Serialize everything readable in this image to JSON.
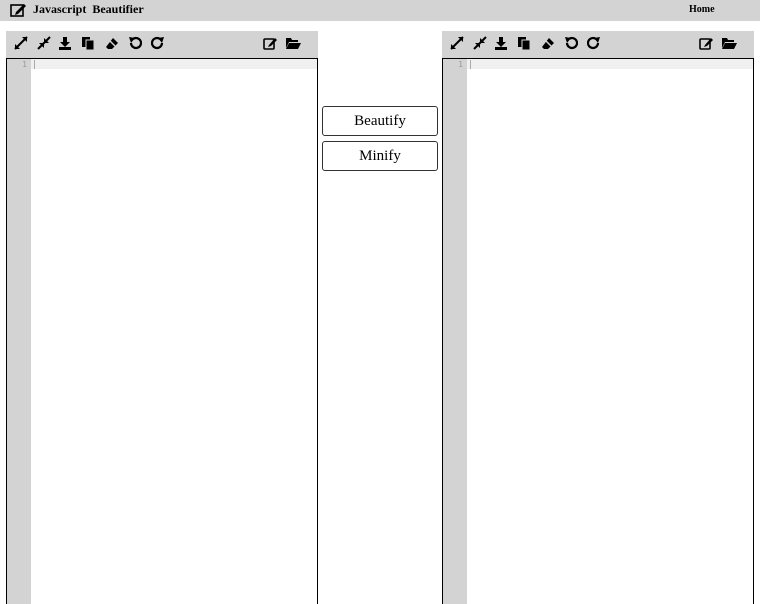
{
  "header": {
    "title": "Javascript  Beautifier",
    "home_label": "Home"
  },
  "actions": {
    "beautify_label": "Beautify",
    "minify_label": "Minify"
  },
  "editors": {
    "input": {
      "line_number": "1",
      "content": ""
    },
    "output": {
      "line_number": "1",
      "content": ""
    }
  },
  "toolbar_icons": [
    "expand-icon",
    "collapse-icon",
    "download-icon",
    "copy-icon",
    "eraser-icon",
    "undo-icon",
    "redo-icon",
    "edit-icon",
    "folder-open-icon"
  ],
  "colors": {
    "header_bg": "#d3d3d3",
    "toolbar_bg": "#d3d3d3",
    "gutter_bg": "#d3d3d3"
  }
}
